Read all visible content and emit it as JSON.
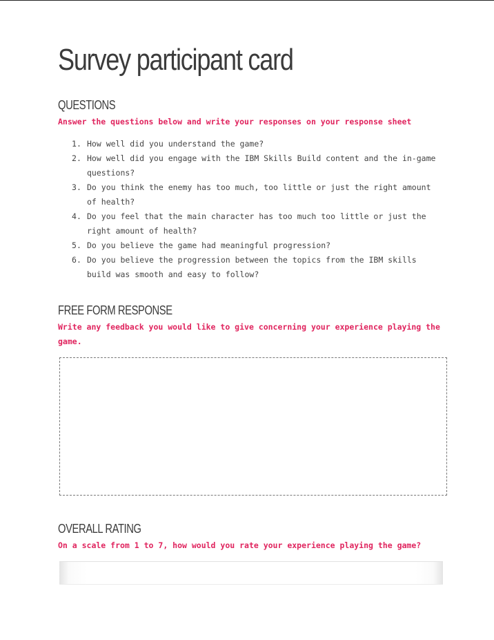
{
  "title": "Survey participant card",
  "questions_section": {
    "heading": "QUESTIONS",
    "instruction": "Answer the questions below and write your responses on your response sheet",
    "items": [
      "How well did you understand the game?",
      "How well did you engage with the IBM Skills Build content and the in-game questions?",
      "Do you think the enemy has too much, too little or just the right amount of health?",
      "Do you feel that the main character has too much too little or just the right amount of health?",
      "Do you believe the game had meaningful progression?",
      "Do you believe the progression between the topics from the IBM skills build was smooth and easy to follow?"
    ]
  },
  "free_form_section": {
    "heading": "FREE FORM RESPONSE",
    "instruction": "Write any feedback you would like to give concerning your experience playing the game.",
    "response_value": ""
  },
  "rating_section": {
    "heading": "OVERALL RATING",
    "instruction": "On a scale from 1 to 7, how would you rate your experience playing the game?",
    "rating_value": ""
  },
  "colors": {
    "accent": "#e0245e",
    "heading": "#3b3b3b",
    "body": "#444444"
  }
}
